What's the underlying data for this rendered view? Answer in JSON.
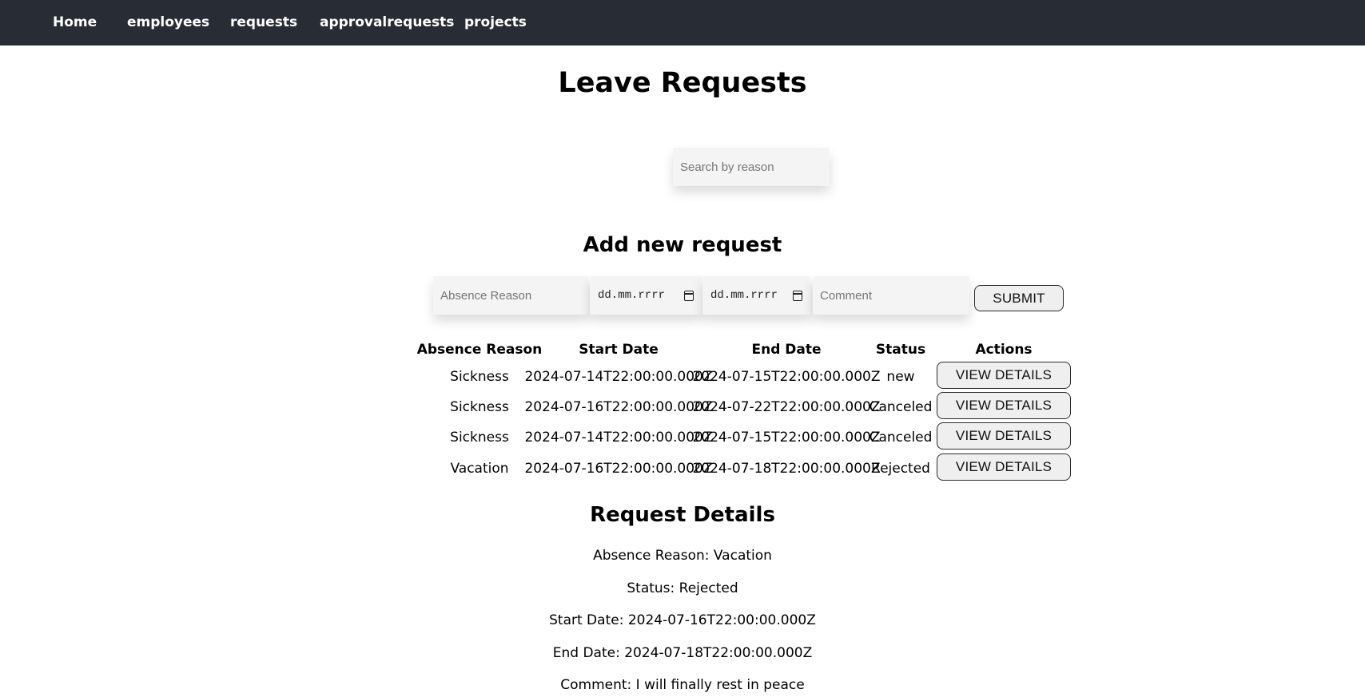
{
  "nav": {
    "items": [
      "Home",
      "employees",
      "requests",
      "approvalrequests",
      "projects"
    ]
  },
  "page": {
    "title": "Leave Requests",
    "search_placeholder": "Search by reason"
  },
  "add_form": {
    "title": "Add new request",
    "reason_placeholder": "Absence Reason",
    "start_date_placeholder": "dd.mm.rrrr",
    "end_date_placeholder": "dd.mm.rrrr",
    "comment_placeholder": "Comment",
    "submit_label": "SUBMIT"
  },
  "table": {
    "headers": [
      "Absence Reason",
      "Start Date",
      "End Date",
      "Status",
      "Actions"
    ],
    "rows": [
      {
        "reason": "Sickness",
        "start": "2024-07-14T22:00:00.000Z",
        "end": "2024-07-15T22:00:00.000Z",
        "status": "new",
        "action": "VIEW DETAILS"
      },
      {
        "reason": "Sickness",
        "start": "2024-07-16T22:00:00.000Z",
        "end": "2024-07-22T22:00:00.000Z",
        "status": "Canceled",
        "action": "VIEW DETAILS"
      },
      {
        "reason": "Sickness",
        "start": "2024-07-14T22:00:00.000Z",
        "end": "2024-07-15T22:00:00.000Z",
        "status": "Canceled",
        "action": "VIEW DETAILS"
      },
      {
        "reason": "Vacation",
        "start": "2024-07-16T22:00:00.000Z",
        "end": "2024-07-18T22:00:00.000Z",
        "status": "Rejected",
        "action": "VIEW DETAILS"
      }
    ]
  },
  "details": {
    "title": "Request Details",
    "lines": [
      "Absence Reason: Vacation",
      "Status: Rejected",
      "Start Date: 2024-07-16T22:00:00.000Z",
      "End Date: 2024-07-18T22:00:00.000Z",
      "Comment: I will finally rest in peace"
    ]
  },
  "colors": {
    "navbar_bg": "#282c34",
    "input_bg": "#f4f4f4",
    "button_bg": "#efefef"
  }
}
